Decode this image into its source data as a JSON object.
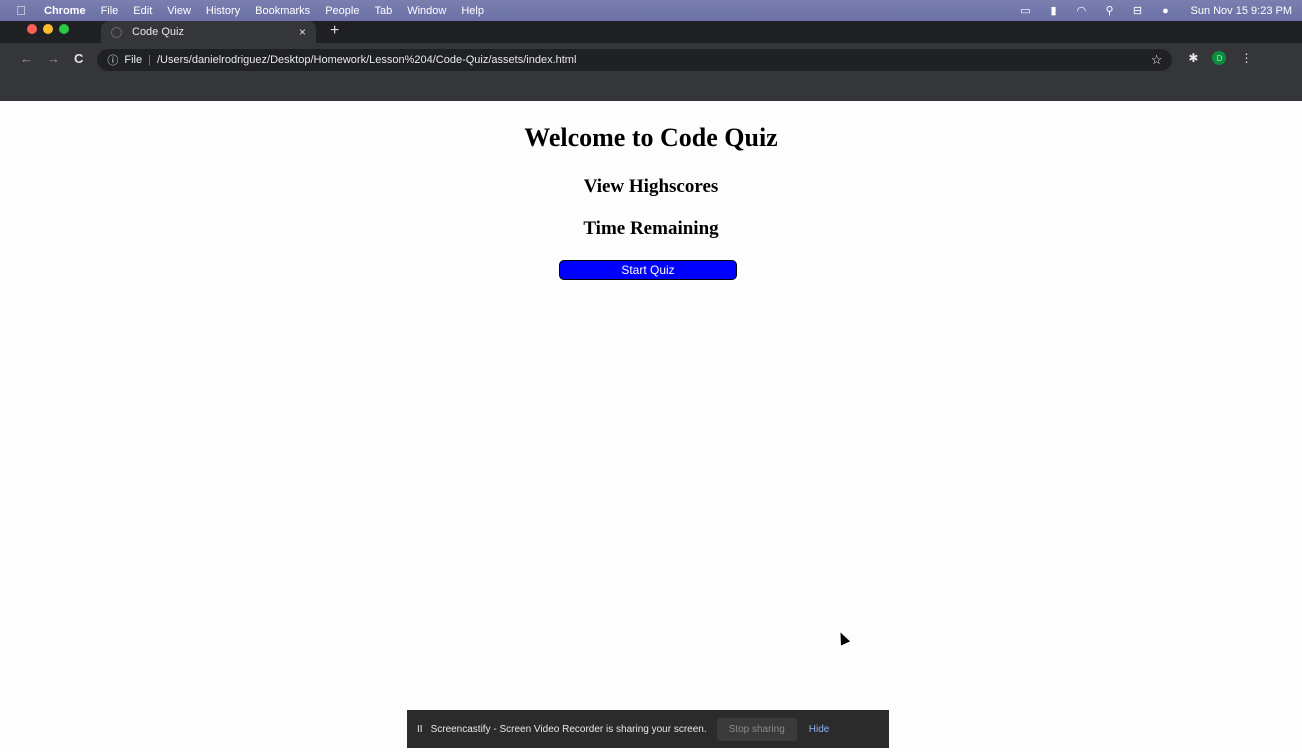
{
  "menubar": {
    "apple_icon": "apple-logo-icon",
    "items": [
      "Chrome",
      "File",
      "Edit",
      "View",
      "History",
      "Bookmarks",
      "People",
      "Tab",
      "Window",
      "Help"
    ],
    "clock": "Sun Nov 15  9:23 PM"
  },
  "browser": {
    "tab_title": "Code Quiz",
    "tab_close": "×",
    "new_tab": "+",
    "address": {
      "scheme": "File",
      "separator": "|",
      "url": "/Users/danielrodriguez/Desktop/Homework/Lesson%204/Code-Quiz/assets/index.html"
    },
    "extension_badge": "D"
  },
  "page": {
    "title": "Welcome to Code Quiz",
    "highscores_heading": "View Highscores",
    "time_heading": "Time Remaining",
    "start_button": "Start Quiz",
    "button_color": "#0000ff"
  },
  "share_bar": {
    "pause": "II",
    "message": "Screencastify - Screen Video Recorder is sharing your screen.",
    "stop_label": "Stop sharing",
    "hide_label": "Hide"
  }
}
